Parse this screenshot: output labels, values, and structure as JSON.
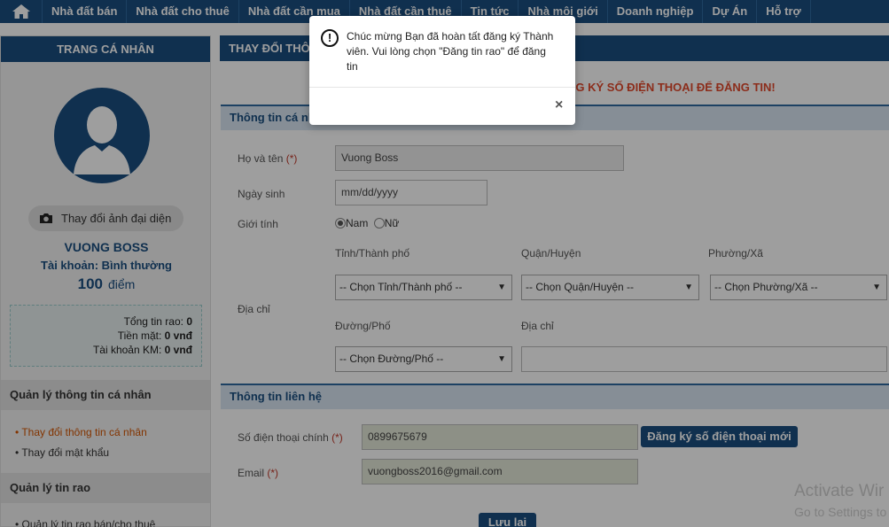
{
  "nav": {
    "items": [
      "Nhà đất bán",
      "Nhà đất cho thuê",
      "Nhà đất cần mua",
      "Nhà đất cần thuê",
      "Tin tức",
      "Nhà môi giới",
      "Doanh nghiệp",
      "Dự Án",
      "Hỗ trợ"
    ]
  },
  "sidebar": {
    "title": "TRANG CÁ NHÂN",
    "change_photo": "Thay đổi ảnh đại diện",
    "user_name": "VUONG BOSS",
    "account_type": "Tài khoản: Bình thường",
    "points_value": "100",
    "points_unit": "điểm",
    "stats": {
      "posts_label": "Tổng tin rao:",
      "posts_value": "0",
      "cash_label": "Tiền mặt:",
      "cash_value": "0 vnđ",
      "promo_label": "Tài khoản KM:",
      "promo_value": "0 vnđ"
    },
    "section_personal": "Quản lý thông tin cá nhân",
    "link_change_info": "• Thay đổi thông tin cá nhân",
    "link_change_password": "• Thay đổi mật khẩu",
    "section_posts": "Quản lý tin rao",
    "link_manage_posts": "• Quản lý tin rao bán/cho thuê"
  },
  "main": {
    "title": "THAY ĐỔI THÔ",
    "notice": "NG KÝ SỐ ĐIỆN THOẠI ĐỂ ĐĂNG TIN!",
    "personal_section": "Thông tin cá nhân",
    "full_name_label": "Họ và tên",
    "required_mark": "(*)",
    "full_name_value": "Vuong Boss",
    "dob_label": "Ngày sinh",
    "dob_placeholder": "mm/dd/yyyy",
    "gender_label": "Giới tính",
    "gender_male": "Nam",
    "gender_female": "Nữ",
    "address_label": "Địa chỉ",
    "province_label": "Tỉnh/Thành phố",
    "province_value": "-- Chọn Tỉnh/Thành phố --",
    "district_label": "Quận/Huyện",
    "district_value": "-- Chọn Quận/Huyện --",
    "ward_label": "Phường/Xã",
    "ward_value": "-- Chọn Phường/Xã --",
    "street_label": "Đường/Phố",
    "street_value": "-- Chọn Đường/Phố --",
    "address_detail_label": "Địa chỉ",
    "contact_section": "Thông tin liên hệ",
    "phone_label": "Số điện thoại chính",
    "phone_value": "0899675679",
    "register_phone_button": "Đăng ký số điện thoại mới",
    "email_label": "Email",
    "email_value": "vuongboss2016@gmail.com",
    "save_button": "Lưu lại"
  },
  "modal": {
    "message": "Chúc mừng Bạn đã hoàn tất đăng ký Thành viên. Vui lòng chọn \"Đăng tin rao\" để đăng tin",
    "icon": "!",
    "close": "×"
  },
  "watermark": {
    "line1": "Activate Wir",
    "line2": "Go to Settings to"
  },
  "colors": {
    "primary": "#1a4e80",
    "accent": "#e2492c"
  }
}
